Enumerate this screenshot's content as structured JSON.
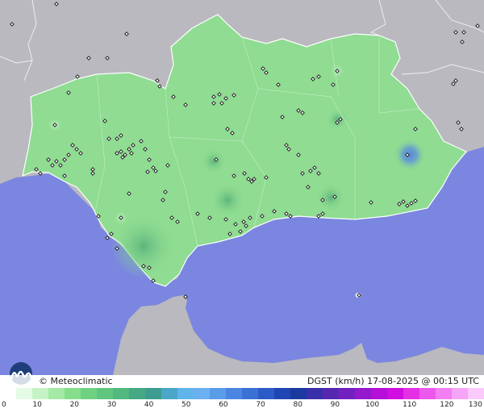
{
  "map": {
    "region": "Andalucía",
    "colors": {
      "sea": "#7b86e0",
      "land_outside": "#b9b9bf",
      "wind_low": "#8fdc92",
      "wind_mid": "#6fc884",
      "wind_high": "#5aa6c8",
      "border": "#ffffff",
      "station_marker": "#1a1a1a"
    },
    "grid": false
  },
  "caption": {
    "brand": "© Meteoclimatic",
    "product": "DGST (km/h)  17-08-2025 @ 00:15 UTC"
  },
  "legend": {
    "unit": "km/h",
    "labels": [
      "0",
      "10",
      "20",
      "30",
      "40",
      "50",
      "60",
      "70",
      "80",
      "90",
      "100",
      "110",
      "120",
      "130"
    ],
    "colors": [
      "#ffffff",
      "#e5fbe5",
      "#c6f3c6",
      "#a4e9a6",
      "#86de8b",
      "#6fd283",
      "#5fc680",
      "#52b87f",
      "#46a983",
      "#3f9c90",
      "#4aa7c8",
      "#5fb5e8",
      "#6bb0f0",
      "#5a9ce8",
      "#4a86e0",
      "#3b70d4",
      "#2c5ac8",
      "#2046b4",
      "#1a3aa0",
      "#3a2fa8",
      "#5628b0",
      "#7420c0",
      "#9418cc",
      "#b410d8",
      "#d00ee0",
      "#e430e4",
      "#ec58ec",
      "#f27ef2",
      "#f6a4f6",
      "#facafa"
    ]
  }
}
